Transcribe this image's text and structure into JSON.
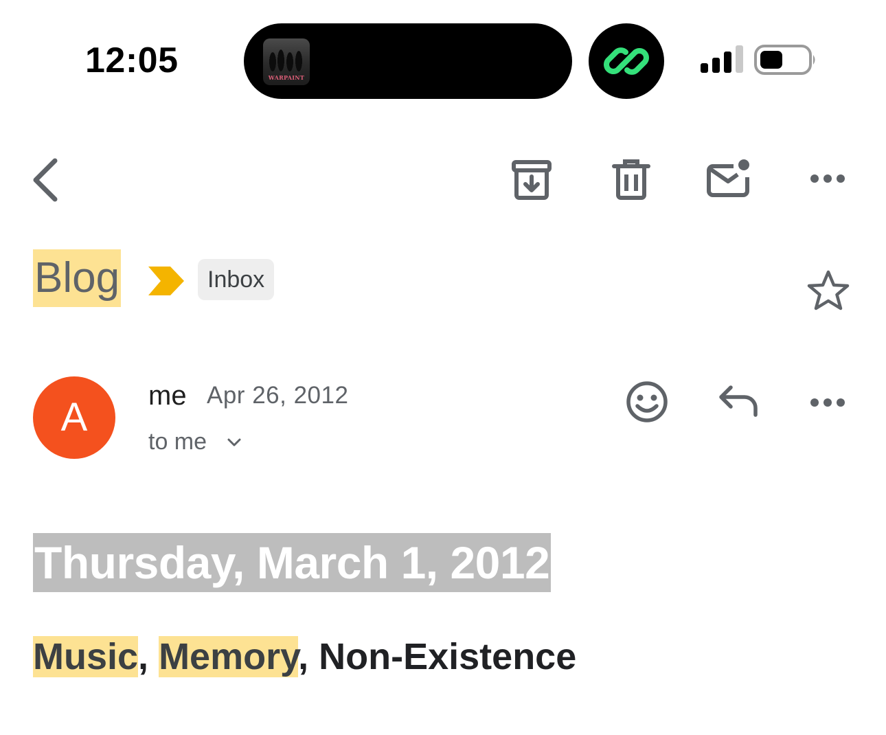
{
  "status_bar": {
    "time": "12:05",
    "now_playing_album_text": "WARPAINT",
    "link_icon": "link-chain-icon",
    "signal_icon": "cellular-signal-icon",
    "battery_icon": "battery-icon"
  },
  "toolbar": {
    "back_icon": "chevron-left-icon",
    "archive_icon": "archive-icon",
    "delete_icon": "trash-icon",
    "mark_unread_icon": "mark-unread-icon",
    "more_icon": "more-horizontal-icon"
  },
  "subject": {
    "text": "Blog",
    "label_chip": "Inbox",
    "importance_icon": "importance-marker-icon",
    "star_icon": "star-outline-icon"
  },
  "message": {
    "avatar_letter": "A",
    "sender": "me",
    "date": "Apr 26, 2012",
    "recipients": "to me",
    "avatar_color": "#f4511e"
  },
  "body": {
    "date_heading": "Thursday, March 1, 2012",
    "title_parts": {
      "music": "Music",
      "sep1": ", ",
      "memory": "Memory",
      "sep2": ", ",
      "rest": "Non-Existence"
    }
  },
  "colors": {
    "highlight": "#fde293",
    "date_highlight": "#bdbdbd",
    "importance": "#f4b400",
    "link_green": "#34e07a",
    "icon_gray": "#5f6368"
  }
}
